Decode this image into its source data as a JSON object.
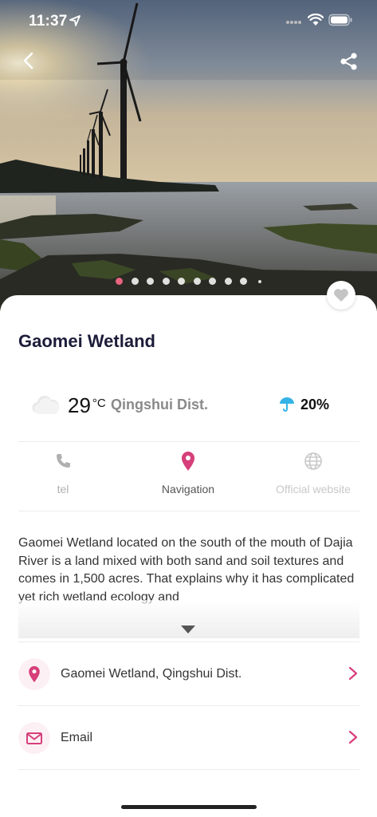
{
  "status_bar": {
    "time": "11:37"
  },
  "gallery": {
    "photo_count": 10,
    "active_index": 0
  },
  "place": {
    "title": "Gaomei Wetland"
  },
  "weather": {
    "temperature": "29",
    "unit": "°C",
    "district": "Qingshui Dist.",
    "rain_chance": "20%"
  },
  "actions": {
    "tel": "tel",
    "navigation": "Navigation",
    "website": "Official website"
  },
  "description": "Gaomei Wetland located on the south of the mouth of Dajia River is a land mixed with both sand and soil textures and comes in 1,500 acres. That explains why it has complicated yet rich wetland ecology and",
  "info_rows": {
    "address": "Gaomei Wetland, Qingshui Dist.",
    "email": "Email"
  },
  "colors": {
    "accent": "#d63f7a",
    "active_dot": "#e8647f",
    "title": "#1c1c3a"
  },
  "icons": [
    "back-icon",
    "share-icon",
    "heart-icon",
    "cloud-icon",
    "umbrella-icon",
    "phone-icon",
    "location-pin-icon",
    "globe-icon",
    "mail-icon",
    "chevron-right-icon",
    "caret-down-icon"
  ]
}
